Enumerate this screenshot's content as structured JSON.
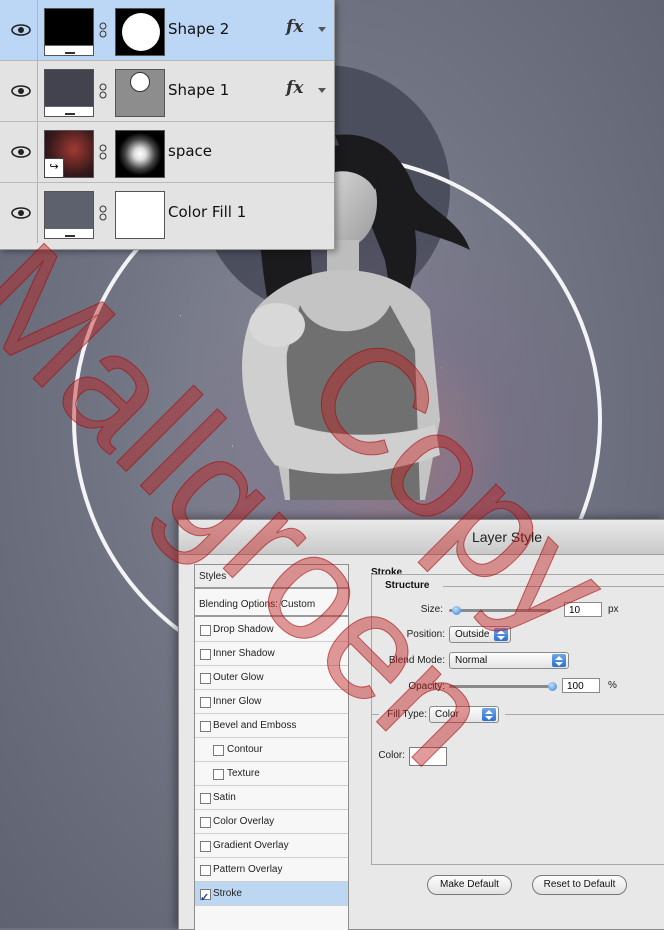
{
  "layers_panel": {
    "layers": [
      {
        "name": "Shape 2",
        "has_fx": true,
        "selected": true
      },
      {
        "name": "Shape 1",
        "has_fx": true,
        "selected": false
      },
      {
        "name": "space",
        "has_fx": false,
        "selected": false
      },
      {
        "name": "Color Fill 1",
        "has_fx": false,
        "selected": false
      }
    ],
    "fx_label": "fx"
  },
  "layer_style_dialog": {
    "title": "Layer Style",
    "styles_list": {
      "header": "Styles",
      "blending": "Blending Options: Custom",
      "items": [
        {
          "label": "Drop Shadow",
          "checked": false
        },
        {
          "label": "Inner Shadow",
          "checked": false
        },
        {
          "label": "Outer Glow",
          "checked": false
        },
        {
          "label": "Inner Glow",
          "checked": false
        },
        {
          "label": "Bevel and Emboss",
          "checked": false
        },
        {
          "label": "Contour",
          "checked": false
        },
        {
          "label": "Texture",
          "checked": false
        },
        {
          "label": "Satin",
          "checked": false
        },
        {
          "label": "Color Overlay",
          "checked": false
        },
        {
          "label": "Gradient Overlay",
          "checked": false
        },
        {
          "label": "Pattern Overlay",
          "checked": false
        },
        {
          "label": "Stroke",
          "checked": true
        }
      ]
    },
    "stroke": {
      "section_title": "Stroke",
      "structure_title": "Structure",
      "size_label": "Size:",
      "size_value": "10",
      "size_unit": "px",
      "position_label": "Position:",
      "position_value": "Outside",
      "blend_mode_label": "Blend Mode:",
      "blend_mode_value": "Normal",
      "opacity_label": "Opacity:",
      "opacity_value": "100",
      "opacity_unit": "%",
      "fill_type_label": "Fill Type:",
      "fill_type_value": "Color",
      "color_label": "Color:",
      "color_value": "#ffffff"
    },
    "buttons": {
      "make_default": "Make Default",
      "reset_default": "Reset to Default"
    }
  },
  "watermark": [
    "Mallgroen",
    "Copy"
  ]
}
